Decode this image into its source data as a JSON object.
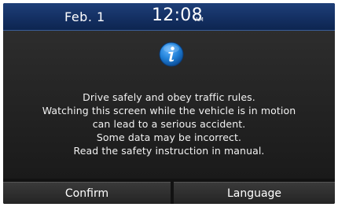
{
  "status_bar": {
    "date": "Feb.  1",
    "time": "12:08",
    "ampm": "AM"
  },
  "dialog": {
    "icon": "info-icon",
    "message_lines": [
      "Drive safely and obey traffic rules.",
      "Watching this screen while the vehicle is in motion",
      "can lead to a serious accident.",
      "Some data may be incorrect.",
      "Read the safety instruction in manual."
    ]
  },
  "buttons": {
    "confirm_label": "Confirm",
    "language_label": "Language"
  },
  "colors": {
    "status_bar": "#143063",
    "icon_blue": "#1f7fd6",
    "background": "#121212"
  }
}
